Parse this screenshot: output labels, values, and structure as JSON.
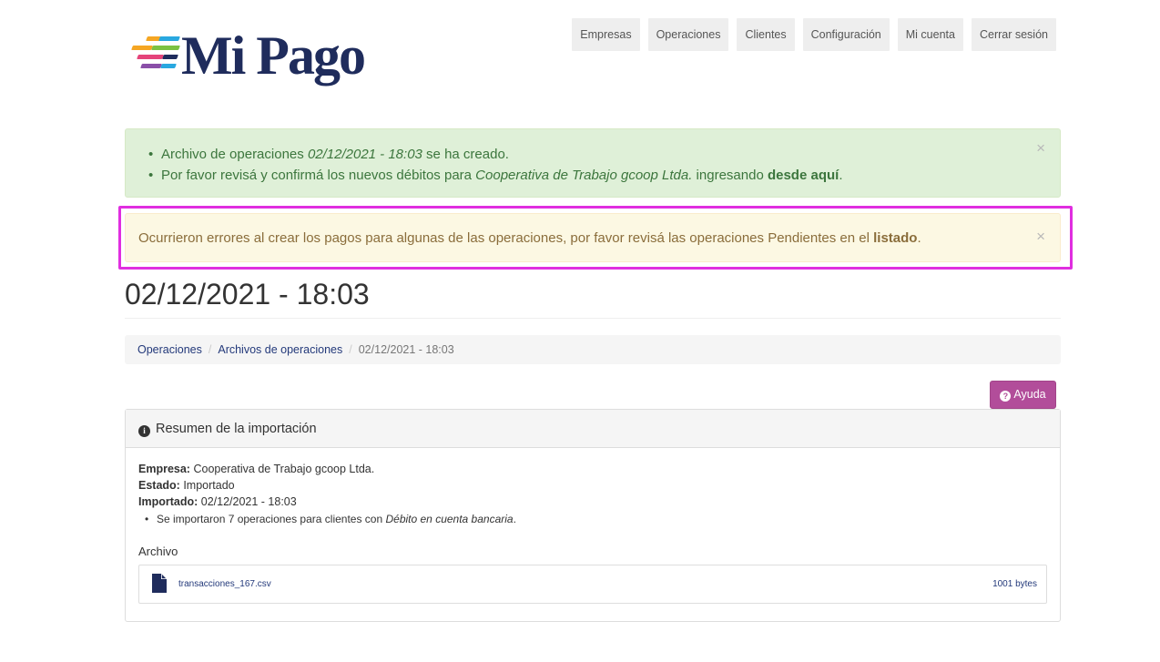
{
  "brand": {
    "logo_text": "Mi Pago",
    "stripe_colors": [
      "#f5a623",
      "#29a8e0",
      "#7cc242",
      "#e5447a",
      "#8a4fa8",
      "#1f2c5c"
    ]
  },
  "nav": {
    "items": [
      "Empresas",
      "Operaciones",
      "Clientes",
      "Configuración",
      "Mi cuenta",
      "Cerrar sesión"
    ]
  },
  "alerts": {
    "success": {
      "line1_prefix": "Archivo de operaciones ",
      "line1_em": "02/12/2021 - 18:03",
      "line1_suffix": " se ha creado.",
      "line2_prefix": "Por favor revisá y confirmá los nuevos débitos para ",
      "line2_em": "Cooperativa de Trabajo gcoop Ltda.",
      "line2_middle": " ingresando ",
      "line2_link": "desde aquí",
      "line2_suffix": ".",
      "close": "×"
    },
    "warning": {
      "text": "Ocurrieron errores al crear los pagos para algunas de las operaciones, por favor revisá las operaciones Pendientes en el ",
      "link": "listado",
      "suffix": ".",
      "close": "×"
    }
  },
  "page": {
    "title": "02/12/2021 - 18:03"
  },
  "breadcrumb": {
    "items": [
      "Operaciones",
      "Archivos de operaciones"
    ],
    "separator": "/",
    "current": "02/12/2021 - 18:03"
  },
  "help_button": {
    "icon": "?",
    "label": "Ayuda"
  },
  "panel": {
    "heading_icon": "i",
    "heading": "Resumen de la importación",
    "empresa_label": "Empresa:",
    "empresa_value": "Cooperativa de Trabajo gcoop Ltda.",
    "estado_label": "Estado:",
    "estado_value": "Importado",
    "importado_label": "Importado:",
    "importado_value": "02/12/2021 - 18:03",
    "bullet_prefix": "Se importaron 7 operaciones para clientes con ",
    "bullet_em": "Débito en cuenta bancaria",
    "bullet_suffix": ".",
    "archivo_label": "Archivo",
    "file_name": "transacciones_167.csv",
    "file_size": "1001 bytes"
  }
}
